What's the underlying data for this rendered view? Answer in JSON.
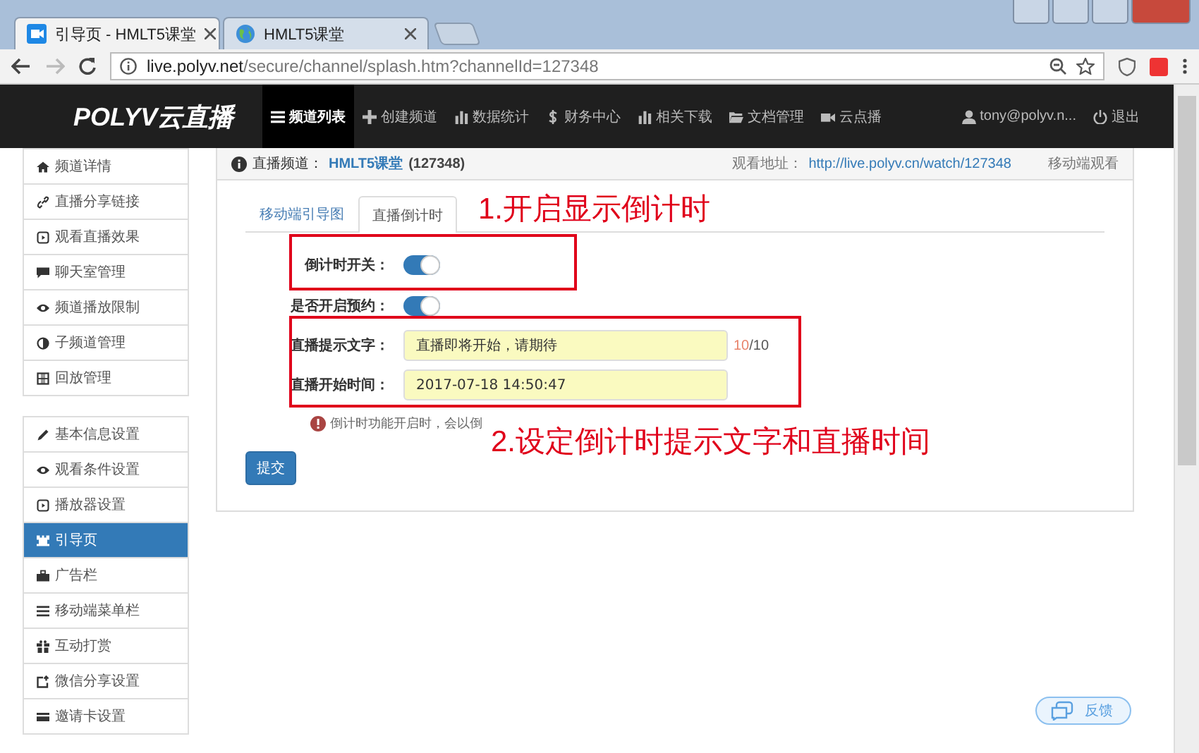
{
  "browser_tabs": [
    {
      "title": "引导页 - HMLT5课堂",
      "selected": true
    },
    {
      "title": "HMLT5课堂",
      "selected": false
    }
  ],
  "address_bar": {
    "host": "live.polyv.net",
    "path": "/secure/channel/splash.htm?channelId=127348"
  },
  "navbar": {
    "logo": "POLYV云直播",
    "items": [
      {
        "label": "频道列表",
        "selected": true
      },
      {
        "label": "创建频道",
        "selected": false
      },
      {
        "label": "数据统计",
        "selected": false
      },
      {
        "label": "财务中心",
        "selected": false
      },
      {
        "label": "相关下载",
        "selected": false
      },
      {
        "label": "文档管理",
        "selected": false
      },
      {
        "label": "云点播",
        "selected": false
      }
    ],
    "user": "tony@polyv.n...",
    "logout": "退出"
  },
  "sidebar": {
    "groups": [
      [
        {
          "label": "频道详情",
          "selected": false
        },
        {
          "label": "直播分享链接",
          "selected": false
        },
        {
          "label": "观看直播效果",
          "selected": false
        },
        {
          "label": "聊天室管理",
          "selected": false
        },
        {
          "label": "频道播放限制",
          "selected": false
        },
        {
          "label": "子频道管理",
          "selected": false
        },
        {
          "label": "回放管理",
          "selected": false
        }
      ],
      [
        {
          "label": "基本信息设置",
          "selected": false
        },
        {
          "label": "观看条件设置",
          "selected": false
        },
        {
          "label": "播放器设置",
          "selected": false
        },
        {
          "label": "引导页",
          "selected": true
        },
        {
          "label": "广告栏",
          "selected": false
        },
        {
          "label": "移动端菜单栏",
          "selected": false
        },
        {
          "label": "互动打赏",
          "selected": false
        },
        {
          "label": "微信分享设置",
          "selected": false
        },
        {
          "label": "邀请卡设置",
          "selected": false
        }
      ]
    ]
  },
  "panel_header": {
    "channel_label": "直播频道：",
    "channel_name": "HMLT5课堂",
    "channel_id": "(127348)",
    "watch_label": "观看地址：",
    "watch_url": "http://live.polyv.cn/watch/127348",
    "mobile_link": "移动端观看"
  },
  "tabs": [
    {
      "label": "移动端引导图",
      "selected": false
    },
    {
      "label": "直播倒计时",
      "selected": true
    }
  ],
  "form": [
    {
      "kind": "toggle",
      "label": "倒计时开关：",
      "on": true
    },
    {
      "kind": "toggle",
      "label": "是否开启预约：",
      "on": true
    },
    {
      "kind": "text",
      "label": "直播提示文字：",
      "value": "直播即将开始，请期待",
      "count": "10",
      "limit": "/10"
    },
    {
      "kind": "text",
      "label": "直播开始时间：",
      "value": "2017-07-18 14:50:47"
    }
  ],
  "hint": "倒计时功能开启时，会以倒",
  "submit": "提交",
  "annotations": [
    "1.开启显示倒计时",
    "2.设定倒计时提示文字和直播时间"
  ],
  "feedback": "反馈"
}
